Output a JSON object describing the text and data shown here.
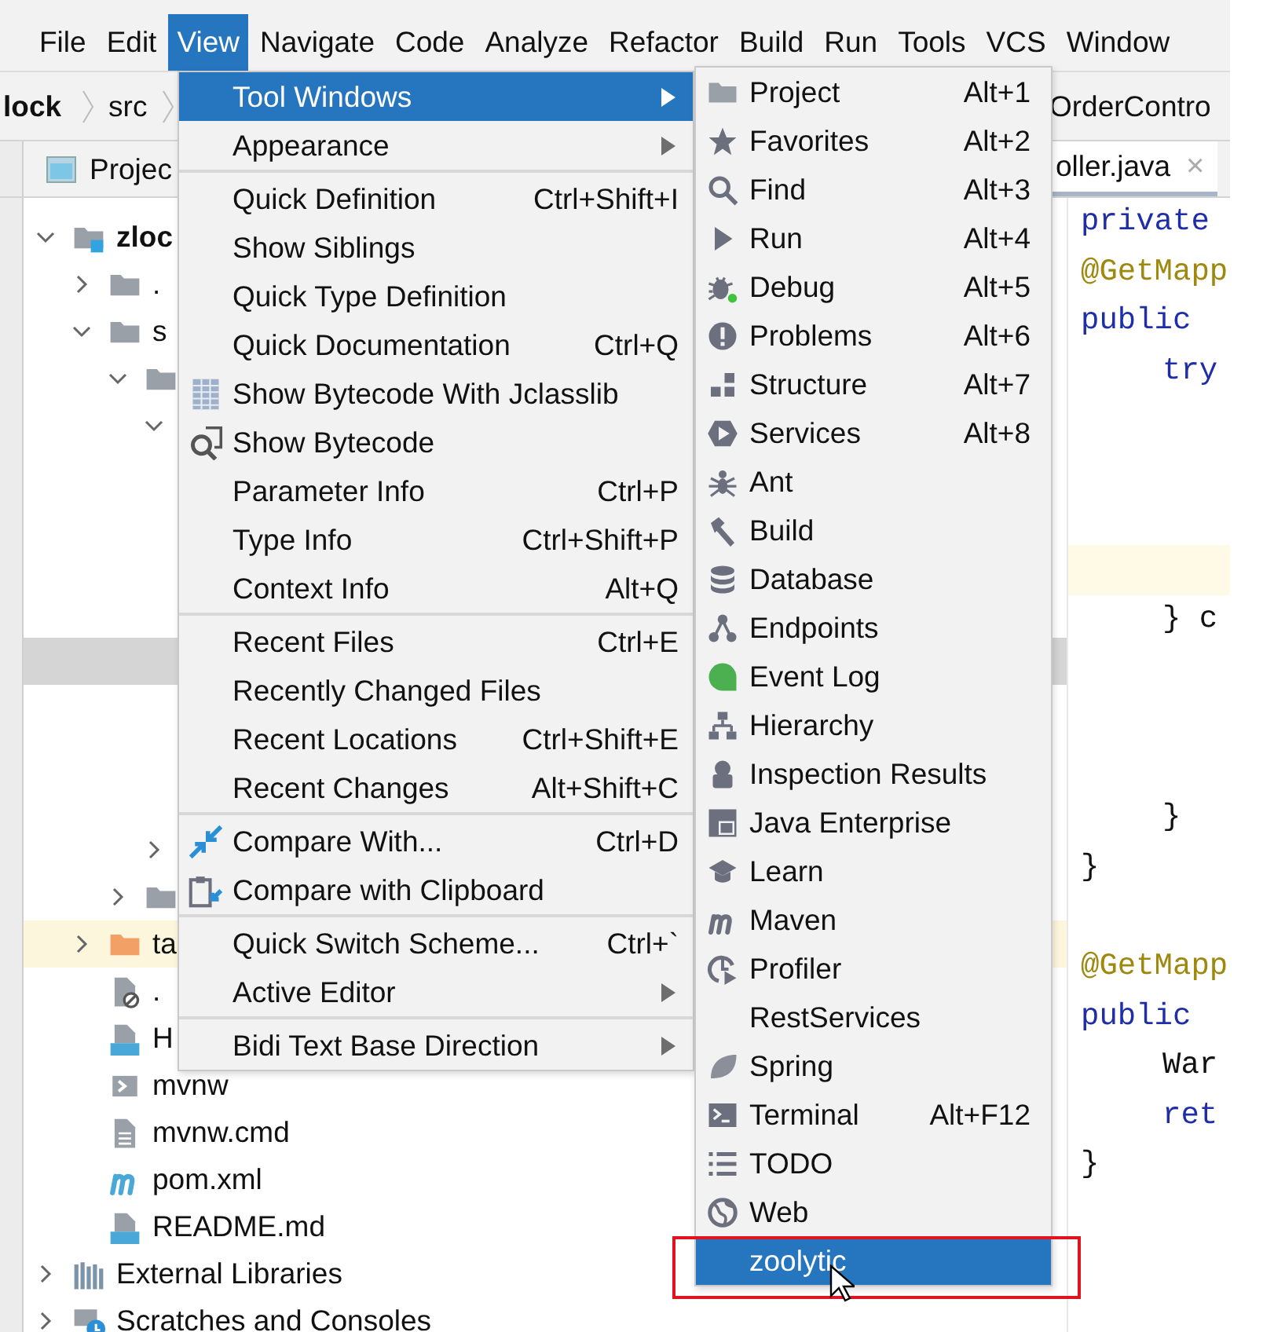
{
  "menubar": [
    {
      "label": "File",
      "selected": false
    },
    {
      "label": "Edit",
      "selected": false
    },
    {
      "label": "View",
      "selected": true
    },
    {
      "label": "Navigate",
      "selected": false
    },
    {
      "label": "Code",
      "selected": false
    },
    {
      "label": "Analyze",
      "selected": false
    },
    {
      "label": "Refactor",
      "selected": false
    },
    {
      "label": "Build",
      "selected": false
    },
    {
      "label": "Run",
      "selected": false
    },
    {
      "label": "Tools",
      "selected": false
    },
    {
      "label": "VCS",
      "selected": false
    },
    {
      "label": "Window",
      "selected": false
    }
  ],
  "breadcrumb": {
    "items": [
      "lock",
      "src"
    ],
    "file": "OrderContro"
  },
  "project_tab": {
    "label": "Projec"
  },
  "editor_tab": {
    "label": "oller.java",
    "close": "×"
  },
  "tree": [
    {
      "kind": "module",
      "label": "zloc",
      "expanded": true,
      "selected": false,
      "highlighted": false,
      "children": [
        {
          "kind": "folder",
          "label": ".",
          "expanded": false,
          "selected": false,
          "highlighted": false
        },
        {
          "kind": "folder",
          "label": "s",
          "expanded": true,
          "selected": false,
          "highlighted": false,
          "children": [
            {
              "kind": "folder",
              "expanded": true,
              "selected": false,
              "highlighted": false,
              "children": [
                {
                  "expanded": true,
                  "selected": false,
                  "highlighted": false,
                  "children": [
                    {
                      "selected": false,
                      "highlighted": false
                    },
                    {
                      "selected": false,
                      "highlighted": false
                    },
                    {
                      "selected": false,
                      "highlighted": false
                    },
                    {
                      "selected": false,
                      "highlighted": false
                    },
                    {
                      "selected": true,
                      "highlighted": false
                    },
                    {
                      "selected": false,
                      "highlighted": false
                    },
                    {
                      "selected": false,
                      "highlighted": false
                    },
                    {
                      "selected": false,
                      "highlighted": false
                    }
                  ]
                },
                {
                  "expanded": false,
                  "selected": false,
                  "highlighted": false
                }
              ]
            },
            {
              "kind": "folder",
              "expanded": false,
              "selected": false,
              "highlighted": false
            }
          ]
        },
        {
          "kind": "folder-orange",
          "label": "ta",
          "expanded": false,
          "selected": false,
          "highlighted": true
        },
        {
          "kind": "ignore-file",
          "label": ".",
          "selected": false,
          "highlighted": false
        },
        {
          "kind": "markdown-file",
          "label": "H",
          "selected": false,
          "highlighted": false
        },
        {
          "kind": "script-file",
          "label": "mvnw",
          "selected": false,
          "highlighted": false
        },
        {
          "kind": "text-file",
          "label": "mvnw.cmd",
          "selected": false,
          "highlighted": false
        },
        {
          "kind": "maven-file",
          "label": "pom.xml",
          "selected": false,
          "highlighted": false
        },
        {
          "kind": "markdown-file",
          "label": "README.md",
          "selected": false,
          "highlighted": false
        }
      ]
    },
    {
      "kind": "libraries",
      "label": "External Libraries",
      "expanded": false,
      "selected": false,
      "highlighted": false
    },
    {
      "kind": "scratches",
      "label": "Scratches and Consoles",
      "expanded": false,
      "selected": false,
      "highlighted": false
    }
  ],
  "code_lines": [
    {
      "kind": "keyword",
      "text": "private",
      "indented": false,
      "current": false
    },
    {
      "kind": "annotation",
      "text": "@GetMapp",
      "indented": false,
      "current": false
    },
    {
      "kind": "keyword",
      "text": "public",
      "indented": false,
      "current": false
    },
    {
      "kind": "keyword",
      "text": "try",
      "indented": true,
      "current": false
    },
    {
      "kind": "blank",
      "current": false
    },
    {
      "kind": "blank",
      "current": false
    },
    {
      "kind": "blank",
      "current": false
    },
    {
      "kind": "blank",
      "current": true
    },
    {
      "kind": "plain",
      "text": "} c",
      "indented": true,
      "current": false
    },
    {
      "kind": "blank",
      "current": false
    },
    {
      "kind": "blank",
      "current": false
    },
    {
      "kind": "blank",
      "current": false
    },
    {
      "kind": "plain",
      "text": "}",
      "indented": true,
      "current": false
    },
    {
      "kind": "plain",
      "text": "}",
      "indented": false,
      "current": false
    },
    {
      "kind": "blank",
      "current": false
    },
    {
      "kind": "annotation",
      "text": "@GetMapp",
      "indented": false,
      "current": false
    },
    {
      "kind": "keyword",
      "text": "public",
      "indented": false,
      "current": false
    },
    {
      "kind": "plain",
      "text": "War",
      "indented": true,
      "current": false
    },
    {
      "kind": "keyword",
      "text": "ret",
      "indented": true,
      "current": false
    },
    {
      "kind": "plain",
      "text": "}",
      "indented": false,
      "current": false
    }
  ],
  "view_menu": {
    "groups": [
      [
        {
          "kind": "plain",
          "label": "Tool Windows",
          "submenu": true,
          "selected": true
        },
        {
          "kind": "plain",
          "label": "Appearance",
          "submenu": true,
          "selected": false
        }
      ],
      [
        {
          "kind": "plain",
          "label": "Quick Definition",
          "shortcut": "Ctrl+Shift+I",
          "submenu": false,
          "selected": false
        },
        {
          "kind": "plain",
          "label": "Show Siblings",
          "submenu": false,
          "selected": false
        },
        {
          "kind": "plain",
          "label": "Quick Type Definition",
          "submenu": false,
          "selected": false
        },
        {
          "kind": "plain",
          "label": "Quick Documentation",
          "shortcut": "Ctrl+Q",
          "submenu": false,
          "selected": false
        },
        {
          "kind": "jclasslib",
          "label": "Show Bytecode With Jclasslib",
          "submenu": false,
          "selected": false
        },
        {
          "kind": "bytecode",
          "label": "Show Bytecode",
          "submenu": false,
          "selected": false
        },
        {
          "kind": "plain",
          "label": "Parameter Info",
          "shortcut": "Ctrl+P",
          "submenu": false,
          "selected": false
        },
        {
          "kind": "plain",
          "label": "Type Info",
          "shortcut": "Ctrl+Shift+P",
          "submenu": false,
          "selected": false
        },
        {
          "kind": "plain",
          "label": "Context Info",
          "shortcut": "Alt+Q",
          "submenu": false,
          "selected": false
        }
      ],
      [
        {
          "kind": "plain",
          "label": "Recent Files",
          "shortcut": "Ctrl+E",
          "submenu": false,
          "selected": false
        },
        {
          "kind": "plain",
          "label": "Recently Changed Files",
          "submenu": false,
          "selected": false
        },
        {
          "kind": "plain",
          "label": "Recent Locations",
          "shortcut": "Ctrl+Shift+E",
          "submenu": false,
          "selected": false
        },
        {
          "kind": "plain",
          "label": "Recent Changes",
          "shortcut": "Alt+Shift+C",
          "submenu": false,
          "selected": false
        }
      ],
      [
        {
          "kind": "compare",
          "label": "Compare With...",
          "shortcut": "Ctrl+D",
          "submenu": false,
          "selected": false
        },
        {
          "kind": "clipboard",
          "label": "Compare with Clipboard",
          "submenu": false,
          "selected": false
        }
      ],
      [
        {
          "kind": "plain",
          "label": "Quick Switch Scheme...",
          "shortcut": "Ctrl+`",
          "submenu": false,
          "selected": false
        },
        {
          "kind": "plain",
          "label": "Active Editor",
          "submenu": true,
          "selected": false
        }
      ],
      [
        {
          "kind": "plain",
          "label": "Bidi Text Base Direction",
          "submenu": true,
          "selected": false
        }
      ]
    ]
  },
  "tool_windows_menu": {
    "items": [
      {
        "kind": "folder",
        "label": "Project",
        "shortcut": "Alt+1",
        "selected": false
      },
      {
        "kind": "star",
        "label": "Favorites",
        "shortcut": "Alt+2",
        "selected": false
      },
      {
        "kind": "find",
        "label": "Find",
        "shortcut": "Alt+3",
        "selected": false
      },
      {
        "kind": "run",
        "label": "Run",
        "shortcut": "Alt+4",
        "selected": false
      },
      {
        "kind": "debug",
        "label": "Debug",
        "shortcut": "Alt+5",
        "selected": false
      },
      {
        "kind": "problems",
        "label": "Problems",
        "shortcut": "Alt+6",
        "selected": false
      },
      {
        "kind": "structure",
        "label": "Structure",
        "shortcut": "Alt+7",
        "selected": false
      },
      {
        "kind": "services",
        "label": "Services",
        "shortcut": "Alt+8",
        "selected": false
      },
      {
        "kind": "ant",
        "label": "Ant",
        "selected": false
      },
      {
        "kind": "build",
        "label": "Build",
        "selected": false
      },
      {
        "kind": "database",
        "label": "Database",
        "selected": false
      },
      {
        "kind": "endpoints",
        "label": "Endpoints",
        "selected": false
      },
      {
        "kind": "event-log",
        "label": "Event Log",
        "selected": false
      },
      {
        "kind": "hierarchy",
        "label": "Hierarchy",
        "selected": false
      },
      {
        "kind": "inspection",
        "label": "Inspection Results",
        "selected": false
      },
      {
        "kind": "java-ee",
        "label": "Java Enterprise",
        "selected": false
      },
      {
        "kind": "learn",
        "label": "Learn",
        "selected": false
      },
      {
        "kind": "maven",
        "label": "Maven",
        "selected": false
      },
      {
        "kind": "profiler",
        "label": "Profiler",
        "selected": false
      },
      {
        "kind": "plain",
        "label": "RestServices",
        "selected": false
      },
      {
        "kind": "spring",
        "label": "Spring",
        "selected": false
      },
      {
        "kind": "terminal",
        "label": "Terminal",
        "shortcut": "Alt+F12",
        "selected": false
      },
      {
        "kind": "todo",
        "label": "TODO",
        "selected": false
      },
      {
        "kind": "web",
        "label": "Web",
        "selected": false
      },
      {
        "kind": "plain",
        "label": "zoolytic",
        "selected": true
      }
    ]
  }
}
